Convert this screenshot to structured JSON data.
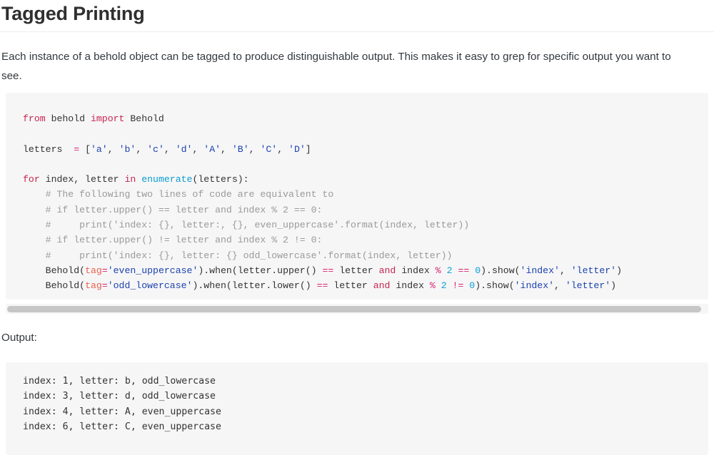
{
  "page": {
    "title": "Tagged Printing",
    "intro": "Each instance of a behold object can be tagged to produce distinguishable output. This makes it easy to grep for specific output you want to see.",
    "output_label": "Output:"
  },
  "colors": {
    "page_background": "#ffffff",
    "code_background": "#f6f6f7",
    "title_text": "#2f2f2f",
    "body_text": "#33383d",
    "code_text": "#333333",
    "keyword": "#c7254e",
    "string": "#1c42ad",
    "builtin": "#0b9dd1",
    "number": "#0b9dd1",
    "operator": "#d6236f",
    "kwarg": "#e8604c",
    "comment": "#9a9a9a",
    "divider": "#eceef0",
    "scrollbar_thumb": "#c6c6c6"
  },
  "code_block": {
    "language": "python",
    "scrollbar": {
      "orientation": "horizontal",
      "visible": true
    },
    "plain_text": "from behold import Behold\n\nletters  = ['a', 'b', 'c', 'd', 'A', 'B', 'C', 'D']\n\nfor index, letter in enumerate(letters):\n    # The following two lines of code are equivalent to\n    # if letter.upper() == letter and index % 2 == 0:\n    #     print('index: {}, letter:, {}, even_uppercase'.format(index, letter))\n    # if letter.upper() != letter and index % 2 != 0:\n    #     print('index: {}, letter: {} odd_lowercase'.format(index, letter))\n    Behold(tag='even_uppercase').when(letter.upper() == letter and index % 2 == 0).show('index', 'letter')\n    Behold(tag='odd_lowercase').when(letter.lower() == letter and index % 2 != 0).show('index', 'letter')",
    "lines": [
      {
        "number": 1,
        "tokens": [
          {
            "t": "from",
            "k": "kw"
          },
          {
            "t": " behold ",
            "k": "plain"
          },
          {
            "t": "import",
            "k": "kw"
          },
          {
            "t": " Behold",
            "k": "plain"
          }
        ]
      },
      {
        "number": 2,
        "tokens": []
      },
      {
        "number": 3,
        "tokens": [
          {
            "t": "letters  ",
            "k": "plain"
          },
          {
            "t": "=",
            "k": "op"
          },
          {
            "t": " [",
            "k": "plain"
          },
          {
            "t": "'a'",
            "k": "str"
          },
          {
            "t": ", ",
            "k": "plain"
          },
          {
            "t": "'b'",
            "k": "str"
          },
          {
            "t": ", ",
            "k": "plain"
          },
          {
            "t": "'c'",
            "k": "str"
          },
          {
            "t": ", ",
            "k": "plain"
          },
          {
            "t": "'d'",
            "k": "str"
          },
          {
            "t": ", ",
            "k": "plain"
          },
          {
            "t": "'A'",
            "k": "str"
          },
          {
            "t": ", ",
            "k": "plain"
          },
          {
            "t": "'B'",
            "k": "str"
          },
          {
            "t": ", ",
            "k": "plain"
          },
          {
            "t": "'C'",
            "k": "str"
          },
          {
            "t": ", ",
            "k": "plain"
          },
          {
            "t": "'D'",
            "k": "str"
          },
          {
            "t": "]",
            "k": "plain"
          }
        ]
      },
      {
        "number": 4,
        "tokens": []
      },
      {
        "number": 5,
        "tokens": [
          {
            "t": "for",
            "k": "kw"
          },
          {
            "t": " index, letter ",
            "k": "plain"
          },
          {
            "t": "in",
            "k": "kw"
          },
          {
            "t": " ",
            "k": "plain"
          },
          {
            "t": "enumerate",
            "k": "fn"
          },
          {
            "t": "(letters):",
            "k": "plain"
          }
        ]
      },
      {
        "number": 6,
        "tokens": [
          {
            "t": "    # The following two lines of code are equivalent to",
            "k": "cmt"
          }
        ]
      },
      {
        "number": 7,
        "tokens": [
          {
            "t": "    # if letter.upper() == letter and index % 2 == 0:",
            "k": "cmt"
          }
        ]
      },
      {
        "number": 8,
        "tokens": [
          {
            "t": "    #     print('index: {}, letter:, {}, even_uppercase'.format(index, letter))",
            "k": "cmt"
          }
        ]
      },
      {
        "number": 9,
        "tokens": [
          {
            "t": "    # if letter.upper() != letter and index % 2 != 0:",
            "k": "cmt"
          }
        ]
      },
      {
        "number": 10,
        "tokens": [
          {
            "t": "    #     print('index: {}, letter: {} odd_lowercase'.format(index, letter))",
            "k": "cmt"
          }
        ]
      },
      {
        "number": 11,
        "tokens": [
          {
            "t": "    Behold(",
            "k": "plain"
          },
          {
            "t": "tag",
            "k": "kwarg"
          },
          {
            "t": "=",
            "k": "op"
          },
          {
            "t": "'even_uppercase'",
            "k": "str"
          },
          {
            "t": ").when(letter.upper() ",
            "k": "plain"
          },
          {
            "t": "==",
            "k": "op"
          },
          {
            "t": " letter ",
            "k": "plain"
          },
          {
            "t": "and",
            "k": "kw"
          },
          {
            "t": " index ",
            "k": "plain"
          },
          {
            "t": "%",
            "k": "op"
          },
          {
            "t": " ",
            "k": "plain"
          },
          {
            "t": "2",
            "k": "num"
          },
          {
            "t": " ",
            "k": "plain"
          },
          {
            "t": "==",
            "k": "op"
          },
          {
            "t": " ",
            "k": "plain"
          },
          {
            "t": "0",
            "k": "num"
          },
          {
            "t": ").show(",
            "k": "plain"
          },
          {
            "t": "'index'",
            "k": "str"
          },
          {
            "t": ", ",
            "k": "plain"
          },
          {
            "t": "'letter'",
            "k": "str"
          },
          {
            "t": ")",
            "k": "plain"
          }
        ]
      },
      {
        "number": 12,
        "tokens": [
          {
            "t": "    Behold(",
            "k": "plain"
          },
          {
            "t": "tag",
            "k": "kwarg"
          },
          {
            "t": "=",
            "k": "op"
          },
          {
            "t": "'odd_lowercase'",
            "k": "str"
          },
          {
            "t": ").when(letter.lower() ",
            "k": "plain"
          },
          {
            "t": "==",
            "k": "op"
          },
          {
            "t": " letter ",
            "k": "plain"
          },
          {
            "t": "and",
            "k": "kw"
          },
          {
            "t": " index ",
            "k": "plain"
          },
          {
            "t": "%",
            "k": "op"
          },
          {
            "t": " ",
            "k": "plain"
          },
          {
            "t": "2",
            "k": "num"
          },
          {
            "t": " ",
            "k": "plain"
          },
          {
            "t": "!=",
            "k": "op"
          },
          {
            "t": " ",
            "k": "plain"
          },
          {
            "t": "0",
            "k": "num"
          },
          {
            "t": ").show(",
            "k": "plain"
          },
          {
            "t": "'index'",
            "k": "str"
          },
          {
            "t": ", ",
            "k": "plain"
          },
          {
            "t": "'letter'",
            "k": "str"
          },
          {
            "t": ")",
            "k": "plain"
          }
        ]
      }
    ]
  },
  "output_block": {
    "lines": [
      "index: 1, letter: b, odd_lowercase",
      "index: 3, letter: d, odd_lowercase",
      "index: 4, letter: A, even_uppercase",
      "index: 6, letter: C, even_uppercase"
    ],
    "text": "index: 1, letter: b, odd_lowercase\nindex: 3, letter: d, odd_lowercase\nindex: 4, letter: A, even_uppercase\nindex: 6, letter: C, even_uppercase"
  }
}
